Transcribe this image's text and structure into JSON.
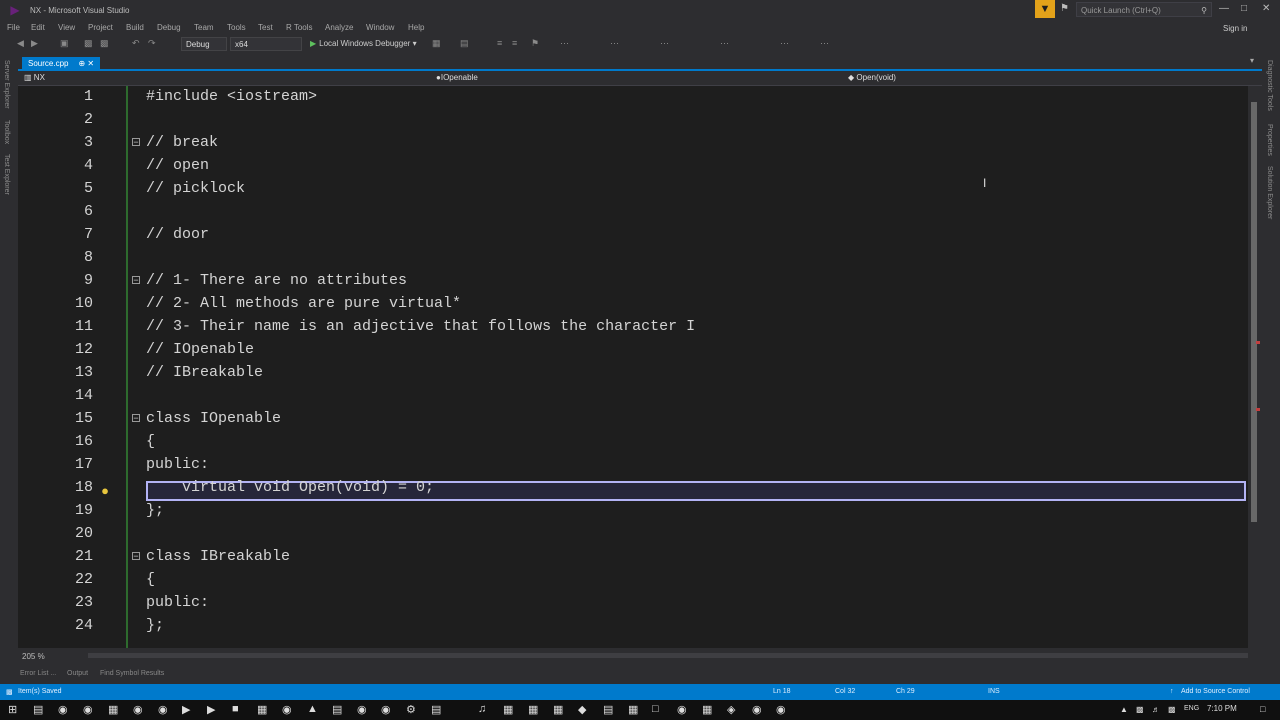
{
  "window": {
    "title": "NX - Microsoft Visual Studio",
    "quick_launch_placeholder": "Quick Launch (Ctrl+Q)",
    "sign_in": "Sign in"
  },
  "menu": [
    "File",
    "Edit",
    "View",
    "Project",
    "Build",
    "Debug",
    "Team",
    "Tools",
    "Test",
    "R Tools",
    "Analyze",
    "Window",
    "Help"
  ],
  "toolbar": {
    "config": "Debug",
    "platform": "x64",
    "debugger": "Local Windows Debugger"
  },
  "tabs": [
    {
      "label": "Source.cpp",
      "active": true
    }
  ],
  "navbar": {
    "project": "NX",
    "scope": "IOpenable",
    "member": "Open(void)"
  },
  "side_tabs_left": [
    "Server Explorer",
    "Toolbox",
    "Test Explorer"
  ],
  "side_tabs_right": [
    "Diagnostic Tools",
    "Properties",
    "Solution Explorer"
  ],
  "code": {
    "lines": [
      {
        "n": "1",
        "t": "#include <iostream>"
      },
      {
        "n": "2",
        "t": ""
      },
      {
        "n": "3",
        "t": "// break"
      },
      {
        "n": "4",
        "t": "// open"
      },
      {
        "n": "5",
        "t": "// picklock"
      },
      {
        "n": "6",
        "t": ""
      },
      {
        "n": "7",
        "t": "// door"
      },
      {
        "n": "8",
        "t": ""
      },
      {
        "n": "9",
        "t": "// 1- There are no attributes"
      },
      {
        "n": "10",
        "t": "// 2- All methods are pure virtual*"
      },
      {
        "n": "11",
        "t": "// 3- Their name is an adjective that follows the character I"
      },
      {
        "n": "12",
        "t": "// IOpenable"
      },
      {
        "n": "13",
        "t": "// IBreakable"
      },
      {
        "n": "14",
        "t": ""
      },
      {
        "n": "15",
        "t": "class IOpenable"
      },
      {
        "n": "16",
        "t": "{"
      },
      {
        "n": "17",
        "t": "public:"
      },
      {
        "n": "18",
        "t": "    virtual void Open(void) = 0;"
      },
      {
        "n": "19",
        "t": "};"
      },
      {
        "n": "20",
        "t": ""
      },
      {
        "n": "21",
        "t": "class IBreakable"
      },
      {
        "n": "22",
        "t": "{"
      },
      {
        "n": "23",
        "t": "public:"
      },
      {
        "n": "24",
        "t": "};"
      }
    ]
  },
  "editor": {
    "zoom": "205 %"
  },
  "bottom_tabs": [
    "Error List ...",
    "Output",
    "Find Symbol Results"
  ],
  "status": {
    "message": "Item(s) Saved",
    "ln": "Ln 18",
    "col": "Col 32",
    "ch": "Ch 29",
    "mode": "INS",
    "source_control": "Add to Source Control"
  },
  "taskbar": {
    "time": "7:10 PM",
    "lang": "ENG"
  },
  "colors": {
    "accent": "#007acc",
    "comment": "#57a64a",
    "keyword": "#569cd6",
    "type": "#4ec9b0"
  }
}
